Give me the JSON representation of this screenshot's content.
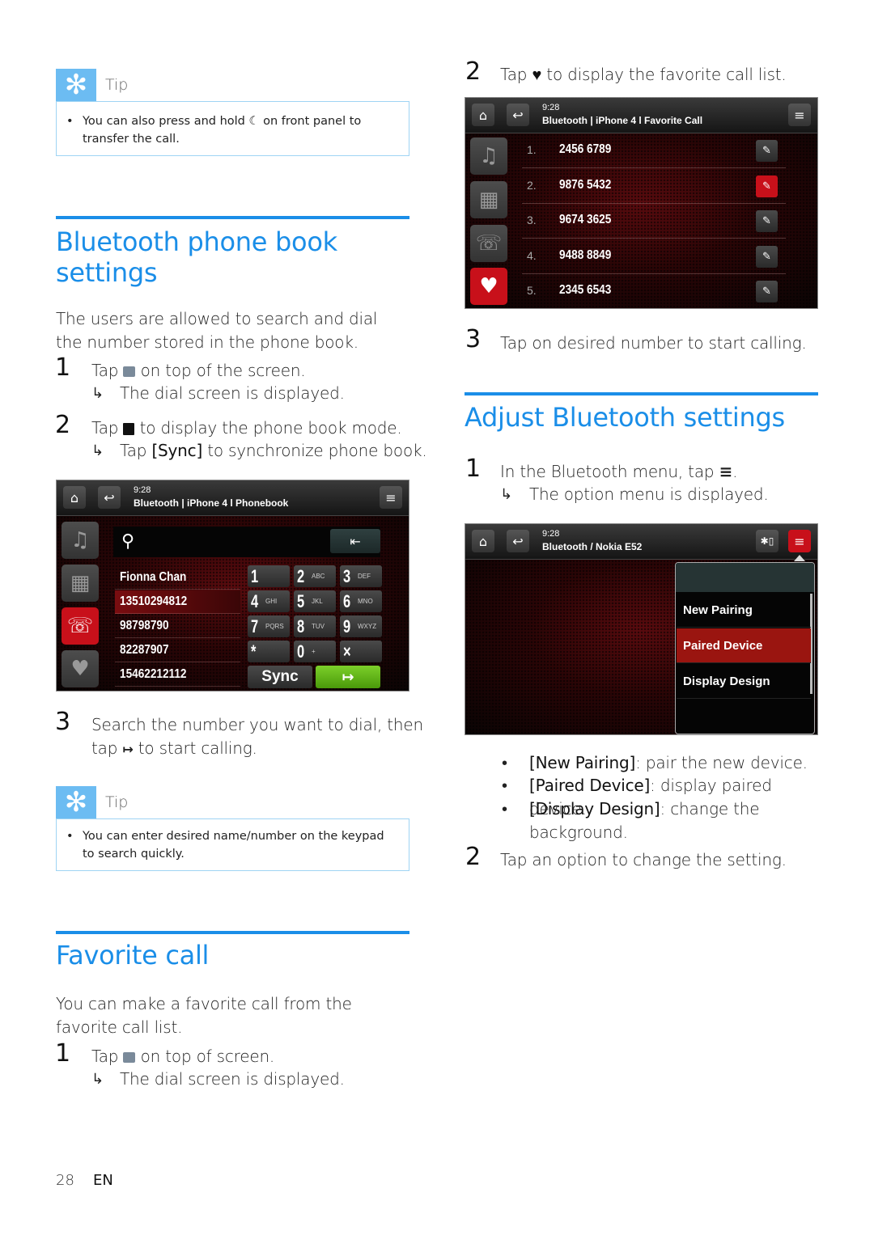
{
  "page": {
    "number": "28",
    "language": "EN"
  },
  "colors": {
    "accent": "#1a8ee8",
    "tip_badge": "#6cbcf2",
    "active_red": "#c8101a",
    "call_green": "#5aaa10"
  },
  "tip1": {
    "label": "Tip",
    "icon": "asterisk-icon",
    "text_before": "You can also press and hold",
    "text_icon": "handset-icon",
    "text_after": "on front panel to transfer the call."
  },
  "phonebook_section": {
    "title": "Bluetooth phone book settings",
    "intro": "The users are allowed to search and dial the number stored in the phone book.",
    "steps": [
      {
        "num": "1",
        "before": "Tap",
        "icon": "dial-icon",
        "after": "on top of the screen.",
        "result": "The dial screen is displayed."
      },
      {
        "num": "2",
        "before": "Tap",
        "icon": "phonebook-icon",
        "after": "to display the phone book mode.",
        "result_before": "Tap",
        "result_kw": "[Sync]",
        "result_after": "to synchronize phone book."
      },
      {
        "num": "3",
        "line1": "Search the number you want to dial, then",
        "line2_before": "tap",
        "icon": "call-icon",
        "line2_after": "to start calling."
      }
    ]
  },
  "phonebook_screen": {
    "time": "9:28",
    "path": "Bluetooth | iPhone 4 l Phonebook",
    "contacts": [
      "Fionna Chan",
      "13510294812",
      "98798790",
      "82287907",
      "15462212112"
    ],
    "selected_index": 1,
    "keys": [
      {
        "d": "1",
        "l": ""
      },
      {
        "d": "2",
        "l": "ABC"
      },
      {
        "d": "3",
        "l": "DEF"
      },
      {
        "d": "4",
        "l": "GHI"
      },
      {
        "d": "5",
        "l": "JKL"
      },
      {
        "d": "6",
        "l": "MNO"
      },
      {
        "d": "7",
        "l": "PQRS"
      },
      {
        "d": "8",
        "l": "TUV"
      },
      {
        "d": "9",
        "l": "WXYZ"
      },
      {
        "d": "*",
        "l": ""
      },
      {
        "d": "0",
        "l": "+"
      },
      {
        "d": "×",
        "l": ""
      }
    ],
    "sync_label": "Sync"
  },
  "tip2": {
    "label": "Tip",
    "text": "You can enter desired name/number on the keypad to search quickly."
  },
  "favorite_section": {
    "title": "Favorite call",
    "intro": "You can make a favorite call from the favorite call list.",
    "steps": [
      {
        "num": "1",
        "before": "Tap",
        "icon": "dial-icon",
        "after": "on top of screen.",
        "result": "The dial screen is displayed."
      },
      {
        "num": "2",
        "before": "Tap",
        "icon": "heart-icon",
        "after": "to display the favorite call list."
      },
      {
        "num": "3",
        "text": "Tap on desired number to start calling."
      }
    ]
  },
  "favorite_screen": {
    "time": "9:28",
    "path": "Bluetooth | iPhone 4 l Favorite Call",
    "entries": [
      {
        "idx": "1.",
        "number": "2456 6789",
        "edit_active": false
      },
      {
        "idx": "2.",
        "number": "9876 5432",
        "edit_active": true
      },
      {
        "idx": "3.",
        "number": "9674 3625",
        "edit_active": false
      },
      {
        "idx": "4.",
        "number": "9488 8849",
        "edit_active": false
      },
      {
        "idx": "5.",
        "number": "2345 6543",
        "edit_active": false
      }
    ]
  },
  "bt_section": {
    "title": "Adjust Bluetooth settings",
    "steps": [
      {
        "num": "1",
        "before": "In the Bluetooth menu, tap",
        "icon": "menu-icon",
        "after": ".",
        "result": "The option menu is displayed."
      },
      {
        "num": "2",
        "text": "Tap an option to change the setting."
      }
    ],
    "bullets": [
      {
        "kw": "[New Pairing]",
        "desc": ": pair the new device."
      },
      {
        "kw": "[Paired Device]",
        "desc": ": display paired device."
      },
      {
        "kw": "[Display Design]",
        "desc": ": change the background."
      }
    ]
  },
  "bt_screen": {
    "time": "9:28",
    "path": "Bluetooth / Nokia E52",
    "menu_items": [
      "New Pairing",
      "Paired Device",
      "Display Design"
    ],
    "selected_index": 1
  }
}
